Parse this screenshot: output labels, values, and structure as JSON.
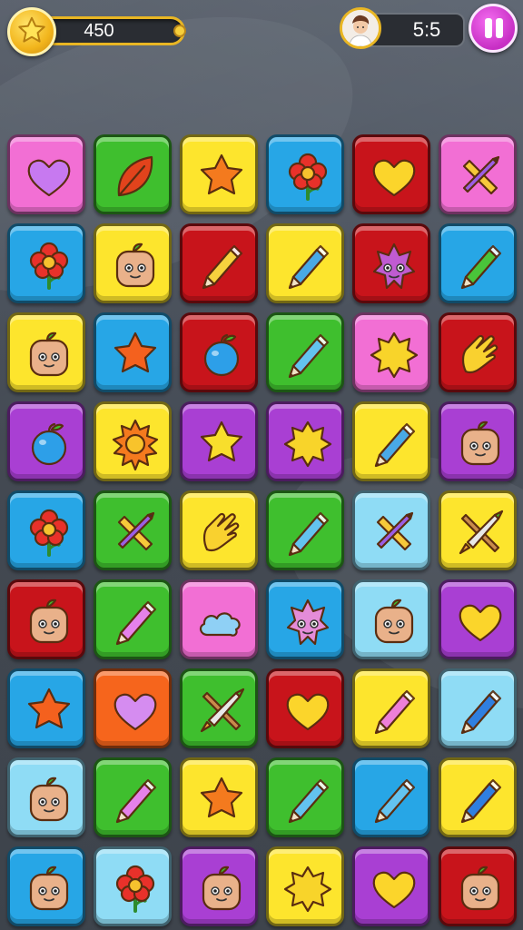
{
  "hud": {
    "score": "450",
    "score_progress": 1.0,
    "moves": "5:5",
    "star_icon": "star-icon",
    "avatar_icon": "player-avatar-icon",
    "pause_icon": "pause-icon"
  },
  "colors": {
    "pink": "#f26fd4",
    "green": "#3fbf2e",
    "yellow": "#fde52d",
    "blue": "#27a6e6",
    "lightblue": "#8fdcf5",
    "red": "#c8141b",
    "orange": "#f6651c",
    "purple": "#a93fd3"
  },
  "board": {
    "rows": 9,
    "cols": 6,
    "tiles": [
      [
        {
          "bg": "pink",
          "icon": "heart",
          "c": "#c779f0"
        },
        {
          "bg": "green",
          "icon": "leaf",
          "c": "#e2431c"
        },
        {
          "bg": "yellow",
          "icon": "star",
          "c": "#f47a1e"
        },
        {
          "bg": "blue",
          "icon": "flower",
          "c": "#e8312a"
        },
        {
          "bg": "red",
          "icon": "heart",
          "c": "#fbd52b"
        },
        {
          "bg": "pink",
          "icon": "pencil-cross",
          "c": "#f6c93a"
        }
      ],
      [
        {
          "bg": "blue",
          "icon": "flower",
          "c": "#e8312a"
        },
        {
          "bg": "yellow",
          "icon": "face",
          "c": "#e9b18a"
        },
        {
          "bg": "red",
          "icon": "crayon",
          "c": "#f6d23e"
        },
        {
          "bg": "yellow",
          "icon": "crayon",
          "c": "#49a9e6"
        },
        {
          "bg": "red",
          "icon": "monster",
          "c": "#c05bd1"
        },
        {
          "bg": "blue",
          "icon": "crayon",
          "c": "#49c43a"
        }
      ],
      [
        {
          "bg": "yellow",
          "icon": "face",
          "c": "#e9b18a"
        },
        {
          "bg": "blue",
          "icon": "star",
          "c": "#f4611e"
        },
        {
          "bg": "red",
          "icon": "apple",
          "c": "#2d9fe8"
        },
        {
          "bg": "green",
          "icon": "crayon",
          "c": "#63c3ef"
        },
        {
          "bg": "pink",
          "icon": "burst",
          "c": "#f8d42a"
        },
        {
          "bg": "red",
          "icon": "hand",
          "c": "#f9d12f"
        }
      ],
      [
        {
          "bg": "purple",
          "icon": "apple",
          "c": "#2d9fe8"
        },
        {
          "bg": "yellow",
          "icon": "sun",
          "c": "#f47a1e"
        },
        {
          "bg": "purple",
          "icon": "star",
          "c": "#f8de2c"
        },
        {
          "bg": "purple",
          "icon": "burst",
          "c": "#f8d42a"
        },
        {
          "bg": "yellow",
          "icon": "crayon",
          "c": "#49a9e6"
        },
        {
          "bg": "purple",
          "icon": "face",
          "c": "#e9b18a"
        }
      ],
      [
        {
          "bg": "blue",
          "icon": "flower",
          "c": "#e8312a"
        },
        {
          "bg": "green",
          "icon": "pencil-cross",
          "c": "#f6c93a"
        },
        {
          "bg": "yellow",
          "icon": "hand",
          "c": "#f9d12f"
        },
        {
          "bg": "green",
          "icon": "crayon",
          "c": "#63c3ef"
        },
        {
          "bg": "lightblue",
          "icon": "pencil-cross",
          "c": "#f6c93a"
        },
        {
          "bg": "yellow",
          "icon": "crossed-tools",
          "c": "#f5a73a"
        }
      ],
      [
        {
          "bg": "red",
          "icon": "face",
          "c": "#e9b18a"
        },
        {
          "bg": "green",
          "icon": "crayon",
          "c": "#e681ea"
        },
        {
          "bg": "pink",
          "icon": "cloud",
          "c": "#8fd0f5"
        },
        {
          "bg": "blue",
          "icon": "monster",
          "c": "#e48cd8"
        },
        {
          "bg": "lightblue",
          "icon": "face",
          "c": "#e9b18a"
        },
        {
          "bg": "purple",
          "icon": "heart",
          "c": "#fbd52b"
        }
      ],
      [
        {
          "bg": "blue",
          "icon": "star",
          "c": "#f4611e"
        },
        {
          "bg": "orange",
          "icon": "heart",
          "c": "#d58cf0"
        },
        {
          "bg": "green",
          "icon": "crossed-tools",
          "c": "#f5a73a"
        },
        {
          "bg": "red",
          "icon": "heart",
          "c": "#fbd52b"
        },
        {
          "bg": "yellow",
          "icon": "crayon",
          "c": "#ee7fd8"
        },
        {
          "bg": "lightblue",
          "icon": "crayon",
          "c": "#2f7fe0"
        }
      ],
      [
        {
          "bg": "lightblue",
          "icon": "face",
          "c": "#e9b18a"
        },
        {
          "bg": "green",
          "icon": "crayon",
          "c": "#e681ea"
        },
        {
          "bg": "yellow",
          "icon": "star",
          "c": "#f47a1e"
        },
        {
          "bg": "green",
          "icon": "crayon",
          "c": "#63c3ef"
        },
        {
          "bg": "blue",
          "icon": "crayon",
          "c": "#63c3ef"
        },
        {
          "bg": "yellow",
          "icon": "crayon",
          "c": "#2f7fe0"
        }
      ],
      [
        {
          "bg": "blue",
          "icon": "face",
          "c": "#e9b18a"
        },
        {
          "bg": "lightblue",
          "icon": "flower",
          "c": "#e8312a"
        },
        {
          "bg": "purple",
          "icon": "face",
          "c": "#e9b18a"
        },
        {
          "bg": "yellow",
          "icon": "burst",
          "c": "#f8d42a"
        },
        {
          "bg": "purple",
          "icon": "heart",
          "c": "#fbd52b"
        },
        {
          "bg": "red",
          "icon": "face",
          "c": "#e9b18a"
        }
      ]
    ]
  }
}
